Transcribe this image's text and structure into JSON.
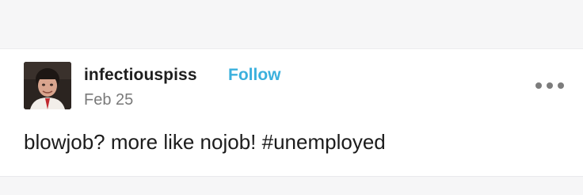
{
  "post": {
    "username": "infectiouspiss",
    "follow_label": "Follow",
    "date": "Feb 25",
    "body_text": "blowjob? more like nojob! ",
    "hashtag": "#unemployed"
  },
  "icons": {
    "avatar": "profile-photo-avatar",
    "more": "more-options-icon"
  },
  "colors": {
    "follow": "#3bb0dd",
    "username": "#1e1e1e",
    "date": "#7a7a7a",
    "body": "#1c1c1c"
  }
}
